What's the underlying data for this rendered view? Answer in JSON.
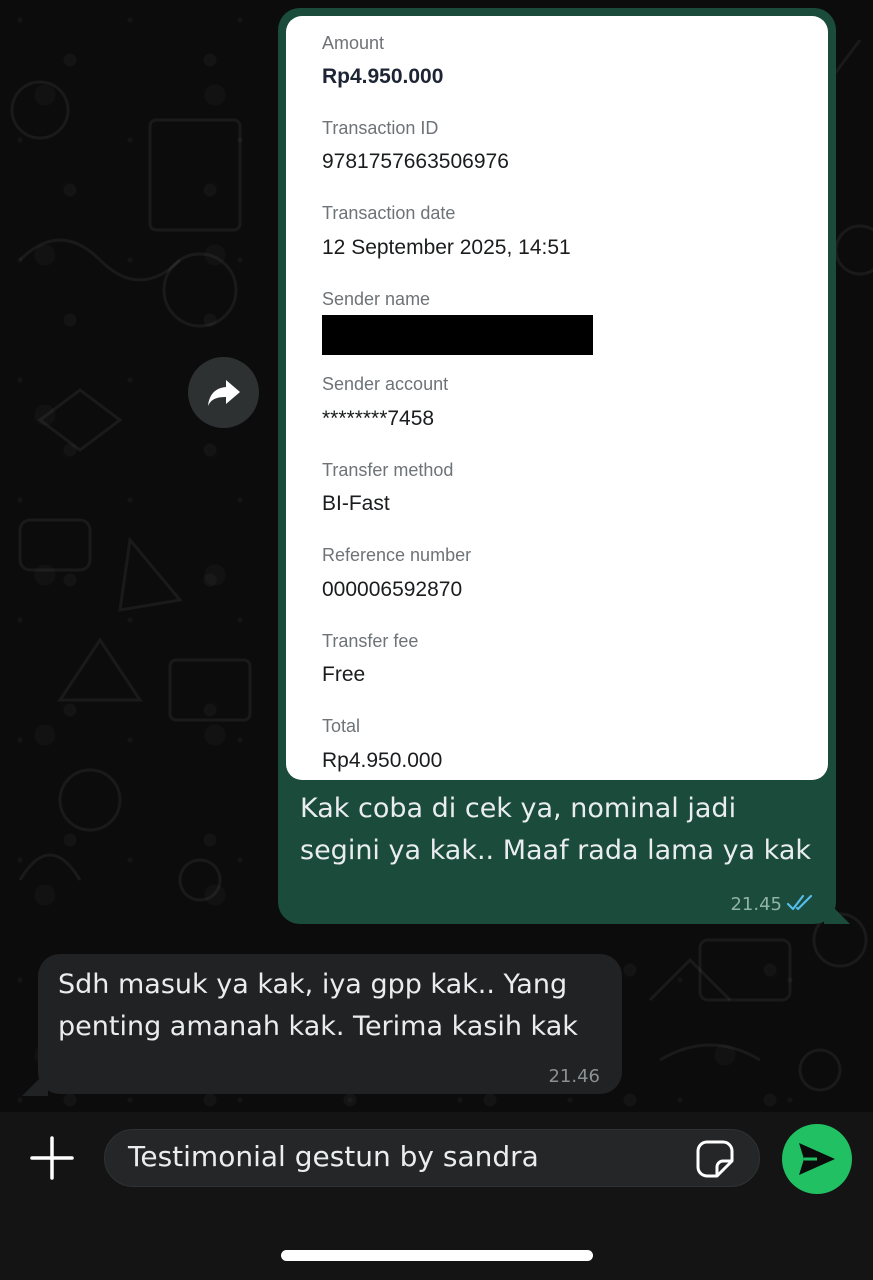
{
  "receipt": {
    "amount_label": "Amount",
    "amount_value": "Rp4.950.000",
    "transaction_id_label": "Transaction ID",
    "transaction_id_value": "9781757663506976",
    "transaction_date_label": "Transaction date",
    "transaction_date_value": "12 September 2025, 14:51",
    "sender_name_label": "Sender name",
    "sender_account_label": "Sender account",
    "sender_account_value": "********7458",
    "transfer_method_label": "Transfer method",
    "transfer_method_value": "BI-Fast",
    "reference_number_label": "Reference number",
    "reference_number_value": "000006592870",
    "transfer_fee_label": "Transfer fee",
    "transfer_fee_value": "Free",
    "total_label": "Total",
    "total_value": "Rp4.950.000"
  },
  "outgoing_message": {
    "text": "Kak coba di cek ya, nominal jadi segini ya kak.. Maaf rada lama ya kak",
    "time": "21.45",
    "status_icon": "double-check-icon"
  },
  "incoming_message": {
    "text": "Sdh masuk ya kak, iya gpp kak.. Yang penting amanah kak. Terima kasih kak",
    "time": "21.46"
  },
  "composer": {
    "input_value": "Testimonial gestun by sandra",
    "attach_icon": "plus-icon",
    "sticker_icon": "sticker-icon",
    "send_icon": "send-icon"
  },
  "colors": {
    "outgoing_bubble": "#1b4b3a",
    "incoming_bubble": "#202223",
    "send_button": "#21c063",
    "read_ticks": "#53bdeb"
  }
}
